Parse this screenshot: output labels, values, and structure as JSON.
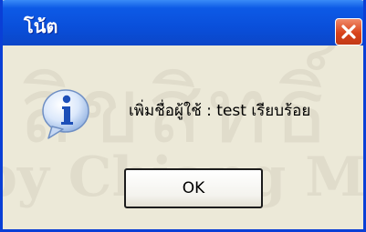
{
  "dialog": {
    "title": "โน้ต",
    "message": "เพิ่มชื่อผู้ใช้ : test เรียบร้อย",
    "ok_label": "OK",
    "icon": "info-icon",
    "close_icon": "close-icon"
  },
  "watermark": {
    "line1": "ลิขสิทธิ์",
    "line2": "by Chiang Mai"
  },
  "colors": {
    "titlebar": "#0a4fda",
    "window_bg": "#ece9d8",
    "close_button": "#d8431b"
  }
}
